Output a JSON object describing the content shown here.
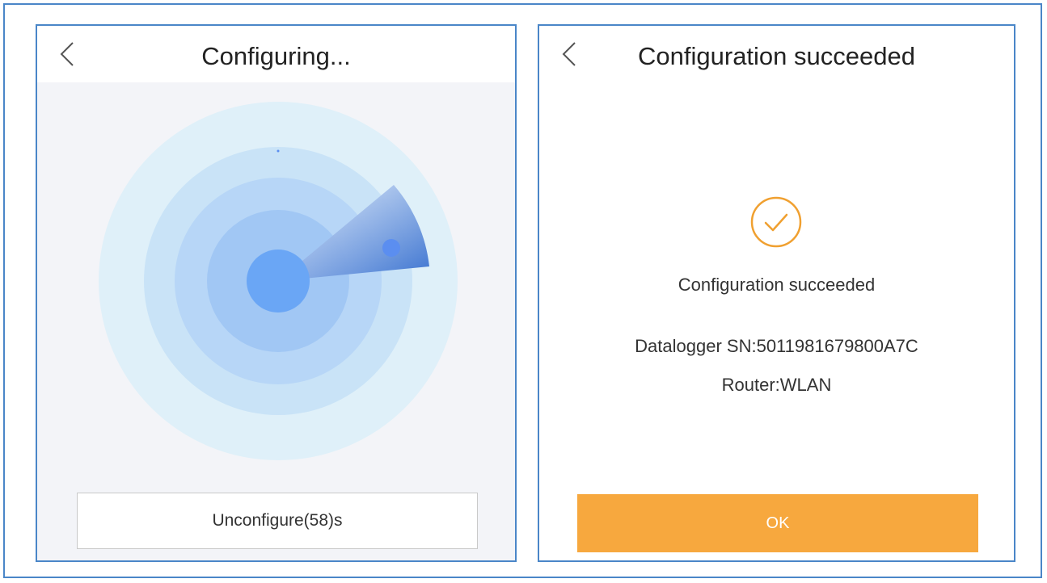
{
  "configuring_screen": {
    "title": "Configuring...",
    "back_icon": "chevron-left-icon",
    "unconfigure_label": "Unconfigure(58)s"
  },
  "success_screen": {
    "title": "Configuration succeeded",
    "back_icon": "chevron-left-icon",
    "status_icon": "check-circle-icon",
    "status_message": "Configuration succeeded",
    "datalogger_sn": "Datalogger SN:5011981679800A7C",
    "router": "Router:WLAN",
    "ok_label": "OK"
  },
  "colors": {
    "frame_border": "#4a86c8",
    "radar_center": "#6aa6f5",
    "radar_sweep": "#3a72d0",
    "success_orange": "#f0a030",
    "ok_button": "#f7a83e"
  }
}
